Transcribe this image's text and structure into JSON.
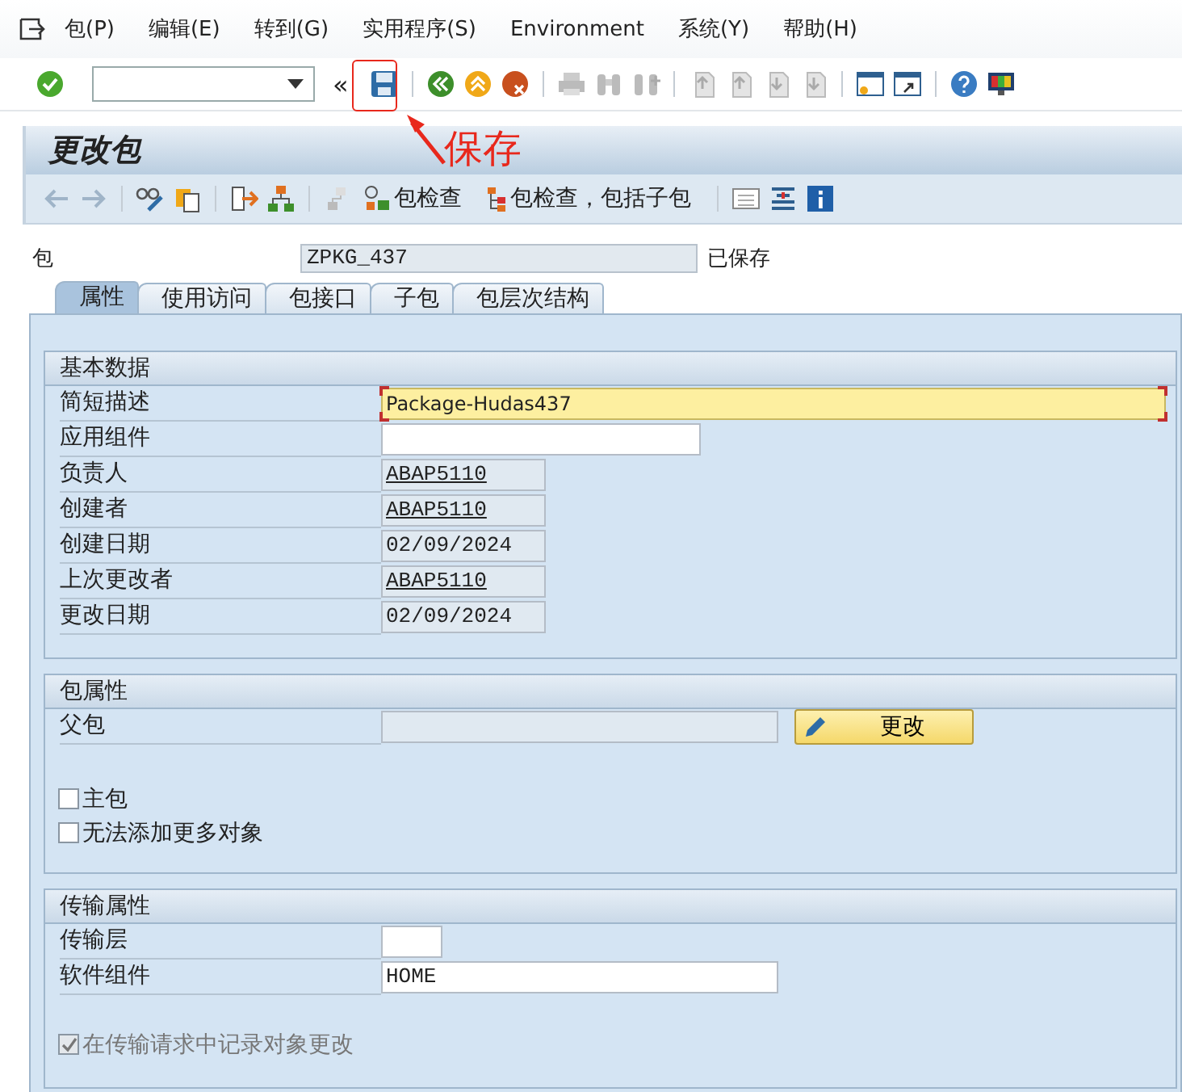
{
  "menu": [
    "包(P)",
    "编辑(E)",
    "转到(G)",
    "实用程序(S)",
    "Environment",
    "系统(Y)",
    "帮助(H)"
  ],
  "toolbar": {
    "collapse": "«"
  },
  "annotation": {
    "text": "保存"
  },
  "title": "更改包",
  "app_toolbar": [
    {
      "label": "包检查"
    },
    {
      "label": "包检查，包括子包"
    }
  ],
  "header": {
    "label": "包",
    "value": "ZPKG_437",
    "status": "已保存"
  },
  "tabs": [
    {
      "label": "属性",
      "selected": true
    },
    {
      "label": "使用访问",
      "selected": false
    },
    {
      "label": "包接口",
      "selected": false
    },
    {
      "label": "子包",
      "selected": false
    },
    {
      "label": "包层次结构",
      "selected": false
    }
  ],
  "sections": [
    {
      "title": "基本数据",
      "fields": [
        {
          "label": "简短描述",
          "value": "Package-Hudas437",
          "kind": "required",
          "link": false
        },
        {
          "label": "应用组件",
          "kind": "input"
        },
        {
          "label": "负责人",
          "value": "ABAP5110",
          "kind": "display",
          "link": true
        },
        {
          "label": "创建者",
          "value": "ABAP5110",
          "kind": "display",
          "link": true
        },
        {
          "label": "创建日期",
          "value": "02/09/2024",
          "kind": "display",
          "link": false
        },
        {
          "label": "上次更改者",
          "value": "ABAP5110",
          "kind": "display",
          "link": true
        },
        {
          "label": "更改日期",
          "value": "02/09/2024",
          "kind": "display",
          "link": false
        }
      ]
    },
    {
      "title": "包属性",
      "fields": [
        {
          "label": "父包",
          "kind": "display",
          "button": "更改"
        }
      ],
      "checkboxes": [
        {
          "label": "主包",
          "checked": false,
          "disabled": false
        },
        {
          "label": "无法添加更多对象",
          "checked": false,
          "disabled": false
        }
      ]
    },
    {
      "title": "传输属性",
      "fields": [
        {
          "label": "传输层",
          "kind": "input"
        },
        {
          "label": "软件组件",
          "value": "HOME",
          "kind": "input",
          "link": false
        }
      ],
      "checkboxes": [
        {
          "label": "在传输请求中记录对象更改",
          "checked": true,
          "disabled": true
        }
      ]
    }
  ]
}
